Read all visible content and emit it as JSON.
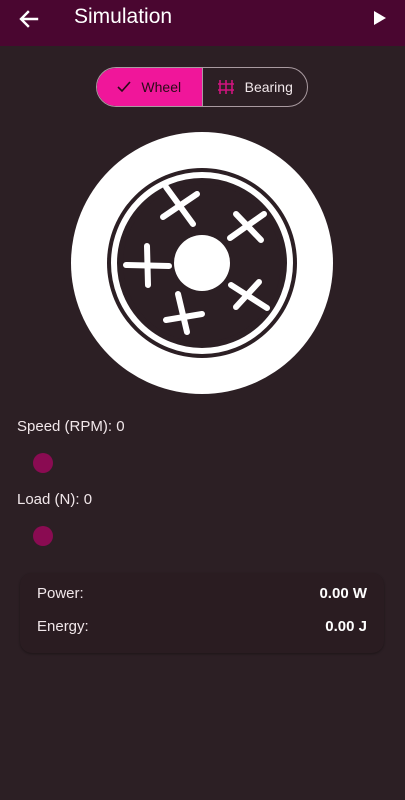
{
  "app_bar": {
    "title": "Simulation",
    "back_icon": "arrow-left-icon",
    "play_icon": "play-icon",
    "color": "#4a0630"
  },
  "mode_toggle": {
    "wheel_label": "Wheel",
    "bearing_label": "Bearing",
    "selected": "Wheel",
    "accent": "#f0169a"
  },
  "controls": {
    "speed_label": "Speed (RPM): 0",
    "speed_value": 0,
    "load_label": "Load (N): 0",
    "load_value": 0,
    "thumb_color": "#8a0b52"
  },
  "results": {
    "power_label": "Power:",
    "power_value": "0.00 W",
    "energy_label": "Energy:",
    "energy_value": "0.00 J"
  }
}
